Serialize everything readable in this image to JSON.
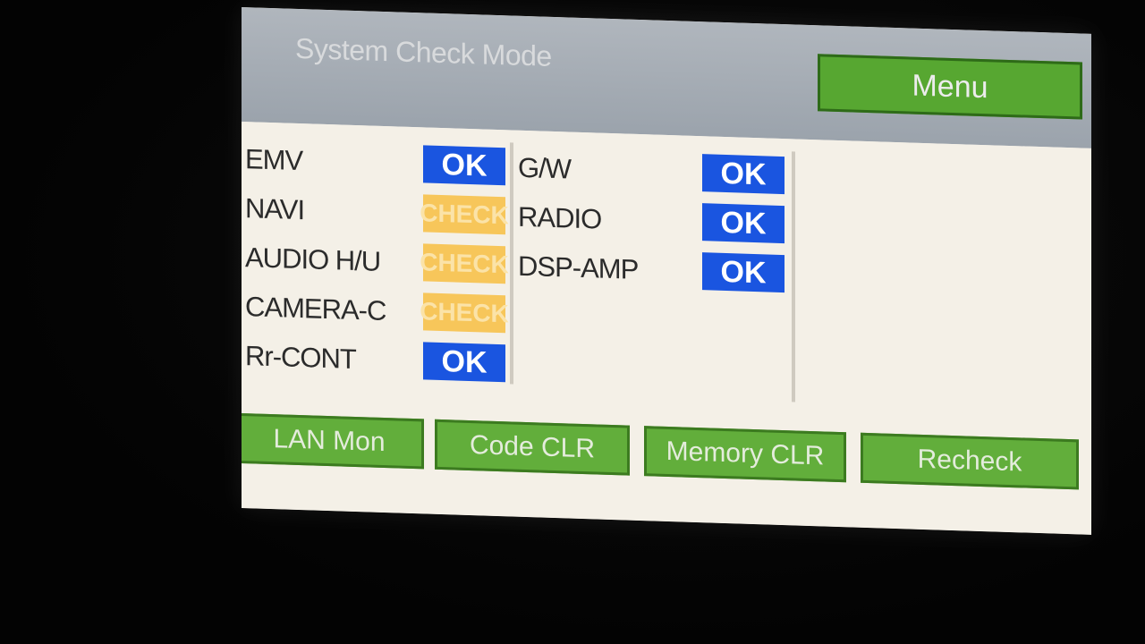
{
  "header": {
    "title": "System Check Mode",
    "menu_label": "Menu"
  },
  "status_left": [
    {
      "label": "EMV",
      "status": "OK",
      "state": "ok"
    },
    {
      "label": "NAVI",
      "status": "CHECK",
      "state": "check"
    },
    {
      "label": "AUDIO H/U",
      "status": "CHECK",
      "state": "check"
    },
    {
      "label": "CAMERA-C",
      "status": "CHECK",
      "state": "check"
    },
    {
      "label": "Rr-CONT",
      "status": "OK",
      "state": "ok"
    }
  ],
  "status_mid": [
    {
      "label": "G/W",
      "status": "OK",
      "state": "ok"
    },
    {
      "label": "RADIO",
      "status": "OK",
      "state": "ok"
    },
    {
      "label": "DSP-AMP",
      "status": "OK",
      "state": "ok"
    }
  ],
  "footer": {
    "lan_mon": "LAN Mon",
    "code_clr": "Code CLR",
    "memory_clr": "Memory CLR",
    "recheck": "Recheck"
  },
  "colors": {
    "ok_badge": "#1a55e0",
    "check_badge": "#f7c65a",
    "button_green": "#57a731",
    "header_gray": "#9ba3ac"
  }
}
